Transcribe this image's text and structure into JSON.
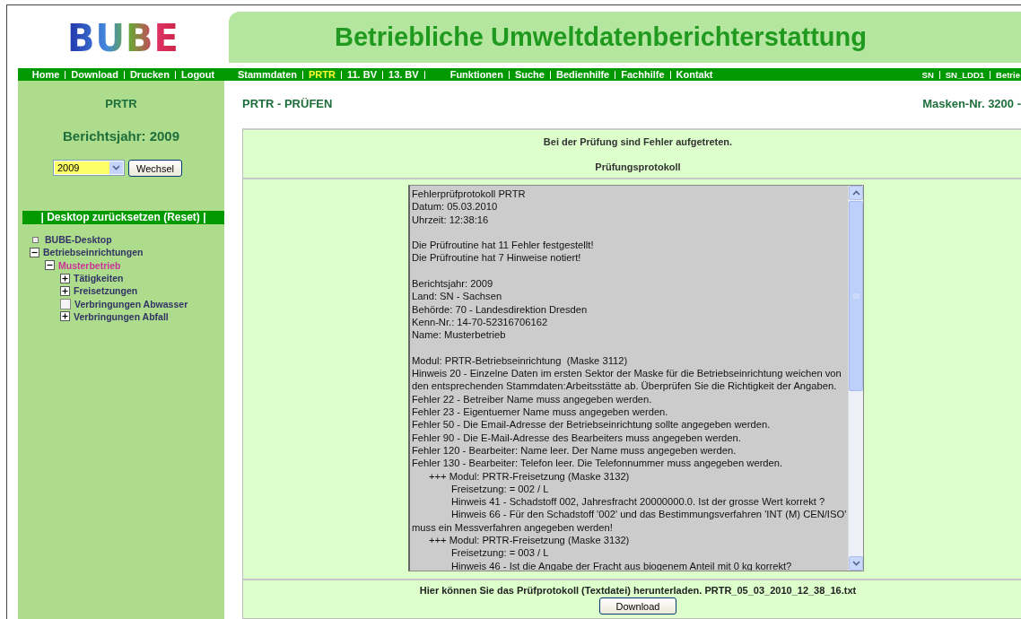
{
  "logo": {
    "text": "BUBE"
  },
  "header": {
    "title": "Betriebliche Umweltdatenberichterstattung"
  },
  "left_nav": [
    "Home",
    "Download",
    "Drucken",
    "Logout"
  ],
  "main_nav": {
    "primary": [
      {
        "label": "Stammdaten",
        "selected": false
      },
      {
        "label": "PRTR",
        "selected": true
      },
      {
        "label": "11. BV",
        "selected": false
      },
      {
        "label": "13. BV",
        "selected": false
      }
    ],
    "secondary": [
      {
        "label": "Funktionen",
        "selected": false
      },
      {
        "label": "Suche",
        "selected": false
      },
      {
        "label": "Bedienhilfe",
        "selected": false
      },
      {
        "label": "Fachhilfe",
        "selected": false
      },
      {
        "label": "Kontakt",
        "selected": false
      }
    ]
  },
  "user_nav": [
    "SN",
    "SN_LDD1",
    "Betrie"
  ],
  "sidebar": {
    "module": "PRTR",
    "year_heading": "Berichtsjahr: 2009",
    "year_select": {
      "value": "2009"
    },
    "change_button": "Wechsel",
    "reset_link": "| Desktop zurücksetzen (Reset) |",
    "tree": [
      {
        "label": "BUBE-Desktop",
        "kind": "square",
        "selected": false
      },
      {
        "label": "Betriebseinrichtungen",
        "kind": "toggle",
        "expanded": true,
        "selected": false,
        "children": [
          {
            "label": "Musterbetrieb",
            "kind": "toggle",
            "expanded": true,
            "selected": true,
            "children": [
              {
                "label": "Tätigkeiten",
                "kind": "toggle",
                "expanded": false,
                "selected": false
              },
              {
                "label": "Freisetzungen",
                "kind": "toggle",
                "expanded": false,
                "selected": false
              },
              {
                "label": "Verbringungen Abwasser",
                "kind": "box",
                "selected": false
              },
              {
                "label": "Verbringungen Abfall",
                "kind": "toggle",
                "expanded": false,
                "selected": false
              }
            ]
          }
        ]
      }
    ]
  },
  "page": {
    "title": "PRTR - PRÜFEN",
    "mask_number": "Masken-Nr. 3200 -"
  },
  "result": {
    "message": "Bei der Prüfung sind Fehler aufgetreten.",
    "protocol_heading": "Prüfungsprotokoll",
    "log_lines": [
      {
        "kind": "plain",
        "text": "Fehlerprüfprotokoll PRTR"
      },
      {
        "kind": "plain",
        "text": "Datum: 05.03.2010"
      },
      {
        "kind": "plain",
        "text": "Uhrzeit: 12:38:16"
      },
      {
        "kind": "blank"
      },
      {
        "kind": "plain",
        "text": "Die Prüfroutine hat 11 Fehler festgestellt!"
      },
      {
        "kind": "plain",
        "text": "Die Prüfroutine hat 7 Hinweise notiert!"
      },
      {
        "kind": "blank"
      },
      {
        "kind": "plain",
        "text": "Berichtsjahr: 2009"
      },
      {
        "kind": "plain",
        "text": "Land: SN - Sachsen"
      },
      {
        "kind": "plain",
        "text": "Behörde: 70 - Landesdirektion Dresden"
      },
      {
        "kind": "plain",
        "text": "Kenn-Nr.: 14-70-52316706162"
      },
      {
        "kind": "plain",
        "text": "Name: Musterbetrieb"
      },
      {
        "kind": "blank"
      },
      {
        "kind": "plain",
        "text": "Modul: PRTR-Betriebseinrichtung  (Maske 3112)"
      },
      {
        "kind": "plain",
        "text": "Hinweis 20 - Einzelne Daten im ersten Sektor der Maske für die Betriebseinrichtung weichen von"
      },
      {
        "kind": "plain",
        "text": "den entsprechenden Stammdaten:Arbeitsstätte ab. Überprüfen Sie die Richtigkeit der Angaben."
      },
      {
        "kind": "plain",
        "text": "Fehler 22 - Betreiber Name muss angegeben werden."
      },
      {
        "kind": "plain",
        "text": "Fehler 23 - Eigentuemer Name muss angegeben werden."
      },
      {
        "kind": "plain",
        "text": "Fehler 50 - Die Email-Adresse der Betriebseinrichtung sollte angegeben werden."
      },
      {
        "kind": "plain",
        "text": "Fehler 90 - Die E-Mail-Adresse des Bearbeiters muss angegeben werden."
      },
      {
        "kind": "plain",
        "text": "Fehler 120 - Bearbeiter: Name leer. Der Name muss angegeben werden."
      },
      {
        "kind": "plain",
        "text": "Fehler 130 - Bearbeiter: Telefon leer. Die Telefonnummer muss angegeben werden."
      },
      {
        "kind": "module",
        "text": "+++ Modul: PRTR-Freisetzung (Maske 3132)"
      },
      {
        "kind": "detail",
        "text": "Freisetzung: = 002 / L"
      },
      {
        "kind": "detail",
        "text": "Hinweis 41 - Schadstoff 002, Jahresfracht 20000000.0. Ist der grosse Wert korrekt ?"
      },
      {
        "kind": "detail",
        "text": "Hinweis 66 - Für den Schadstoff '002' und das Bestimmungsverfahren 'INT (M) CEN/ISO'"
      },
      {
        "kind": "plain",
        "text": "muss ein Messverfahren angegeben werden!"
      },
      {
        "kind": "module",
        "text": "+++ Modul: PRTR-Freisetzung (Maske 3132)"
      },
      {
        "kind": "detail",
        "text": "Freisetzung: = 003 / L"
      },
      {
        "kind": "detail",
        "text": "Hinweis 46 - Ist die Angabe der Fracht aus biogenem Anteil mit 0 kg korrekt?"
      }
    ],
    "download_text": "Hier können Sie das Prüfprotokoll (Textdatei) herunterladen. PRTR_05_03_2010_12_38_16.txt",
    "download_button": "Download"
  }
}
